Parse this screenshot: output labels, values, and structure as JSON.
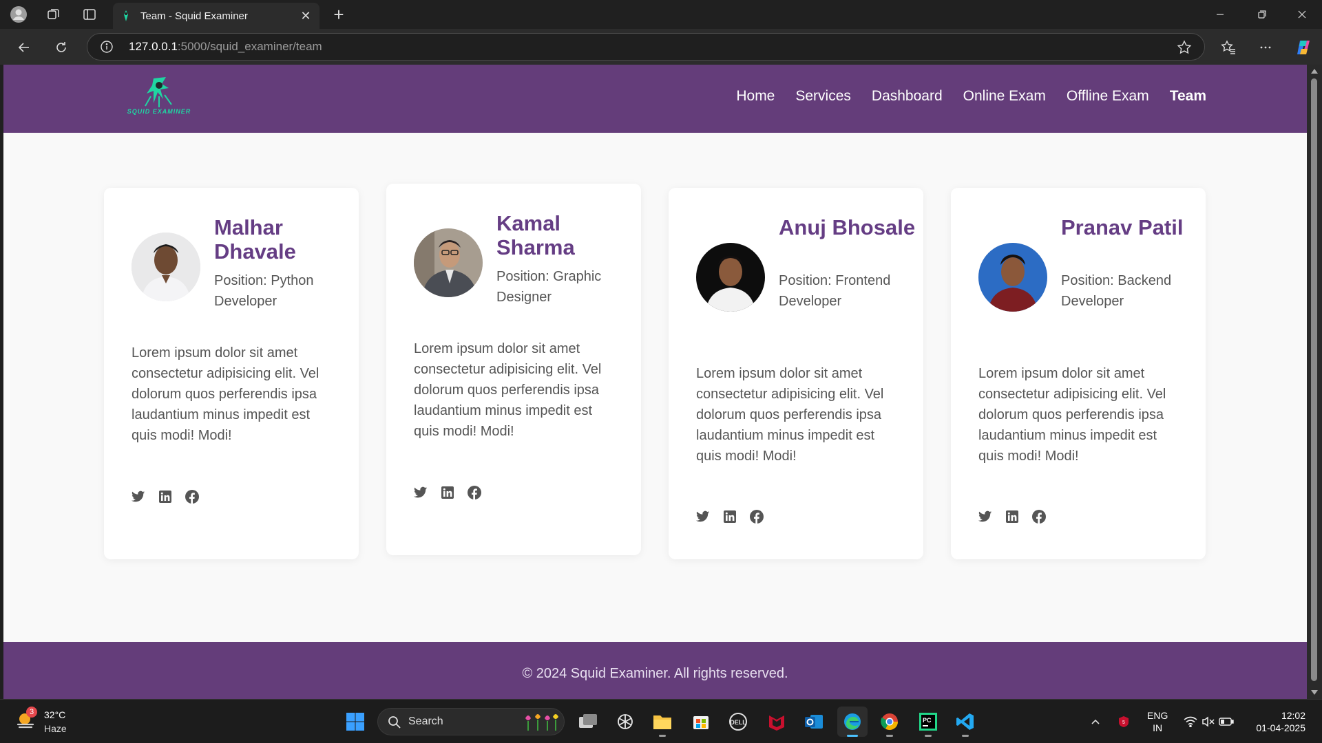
{
  "browser": {
    "tab_title": "Team - Squid Examiner",
    "url_host": "127.0.0.1",
    "url_path": ":5000/squid_examiner/team"
  },
  "site": {
    "logo_text": "SQUID EXAMINER",
    "nav": [
      {
        "label": "Home",
        "active": false
      },
      {
        "label": "Services",
        "active": false
      },
      {
        "label": "Dashboard",
        "active": false
      },
      {
        "label": "Online Exam",
        "active": false
      },
      {
        "label": "Offline Exam",
        "active": false
      },
      {
        "label": "Team",
        "active": true
      }
    ],
    "accent_color": "#643d7a",
    "name_color": "#653d84"
  },
  "team": [
    {
      "name": "Malhar Dhavale",
      "position": "Position: Python Developer",
      "bio": "Lorem ipsum dolor sit amet consectetur adipisicing elit. Vel dolorum quos perferendis ipsa laudantium minus impedit est quis modi! Modi!",
      "socials": [
        "twitter-icon",
        "linkedin-icon",
        "facebook-icon"
      ]
    },
    {
      "name": "Kamal Sharma",
      "position": "Position: Graphic Designer",
      "bio": "Lorem ipsum dolor sit amet consectetur adipisicing elit. Vel dolorum quos perferendis ipsa laudantium minus impedit est quis modi! Modi!",
      "socials": [
        "twitter-icon",
        "linkedin-icon",
        "facebook-icon"
      ]
    },
    {
      "name": "Anuj Bhosale",
      "position": "Position: Frontend Developer",
      "bio": "Lorem ipsum dolor sit amet consectetur adipisicing elit. Vel dolorum quos perferendis ipsa laudantium minus impedit est quis modi! Modi!",
      "socials": [
        "twitter-icon",
        "linkedin-icon",
        "facebook-icon"
      ]
    },
    {
      "name": "Pranav Patil",
      "position": "Position: Backend Developer",
      "bio": "Lorem ipsum dolor sit amet consectetur adipisicing elit. Vel dolorum quos perferendis ipsa laudantium minus impedit est quis modi! Modi!",
      "socials": [
        "twitter-icon",
        "linkedin-icon",
        "facebook-icon"
      ]
    }
  ],
  "footer": {
    "text": "© 2024 Squid Examiner. All rights reserved."
  },
  "taskbar": {
    "weather_temp": "32°C",
    "weather_cond": "Haze",
    "weather_badge": "3",
    "search_label": "Search",
    "lang_top": "ENG",
    "lang_bottom": "IN",
    "time": "12:02",
    "date": "01-04-2025"
  }
}
